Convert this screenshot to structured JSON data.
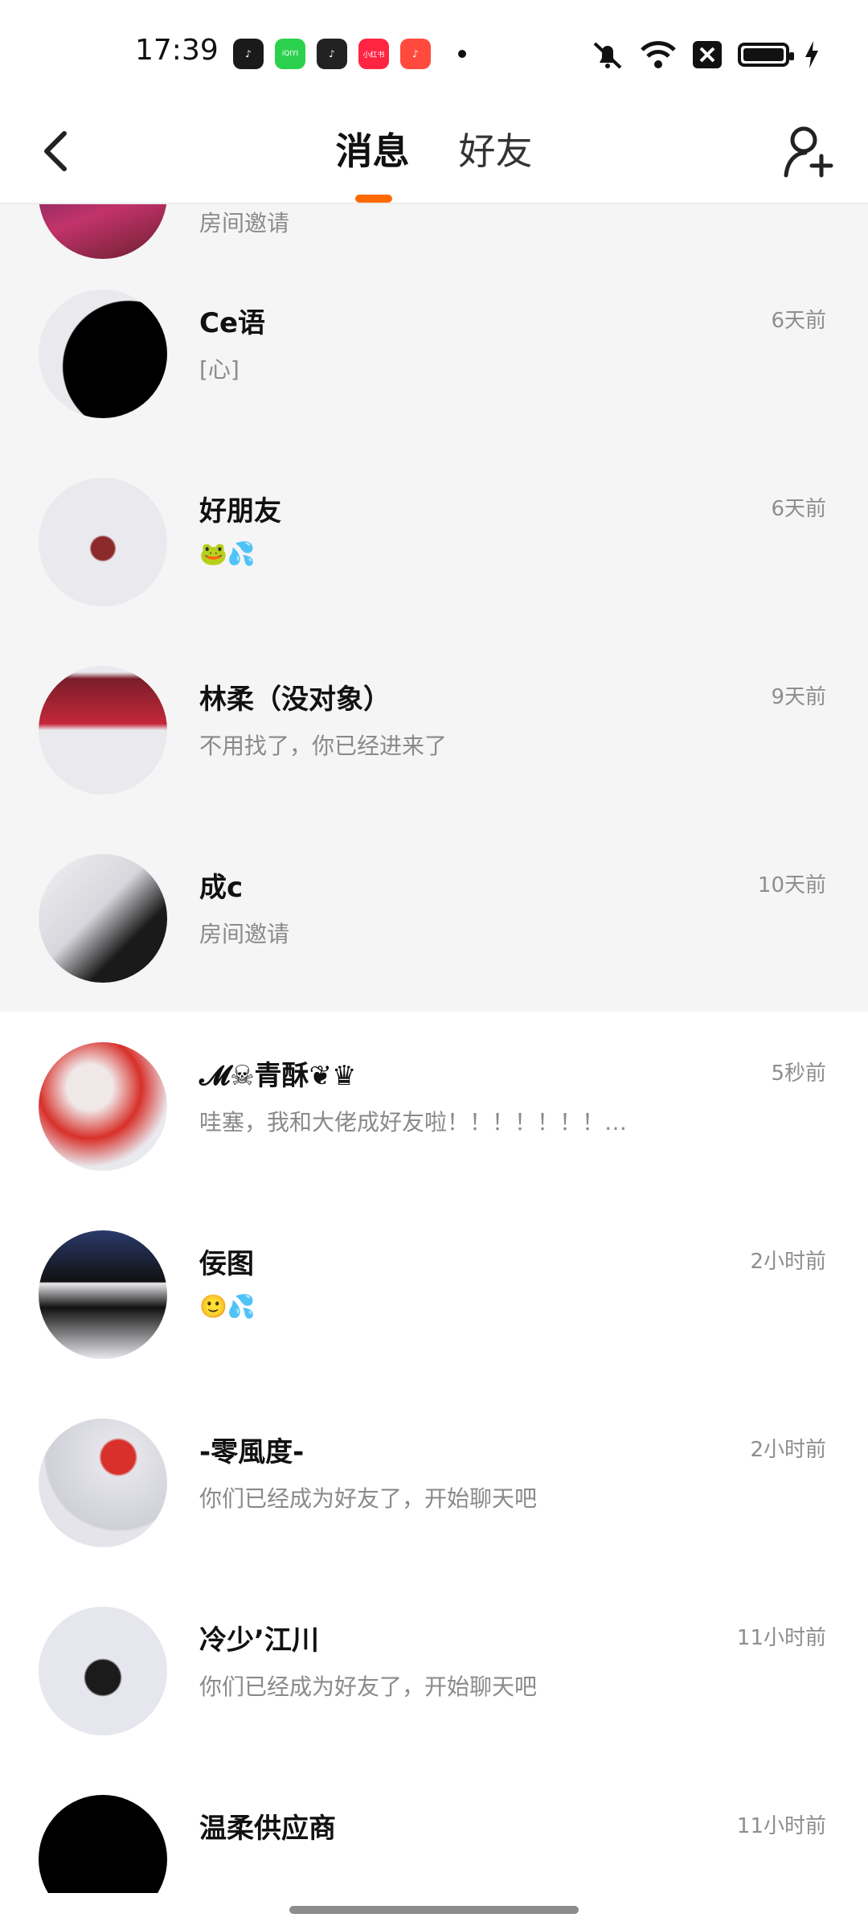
{
  "status_bar": {
    "time": "17:39",
    "apps": [
      {
        "name": "tiktok",
        "color": "#1a1a1a",
        "label": "♪"
      },
      {
        "name": "iqiyi",
        "color": "#2bd14d",
        "label": "iQIYI"
      },
      {
        "name": "tiktok-lite",
        "color": "#222222",
        "label": "♪"
      },
      {
        "name": "xiaohongshu",
        "color": "#ff2442",
        "label": "小红书"
      },
      {
        "name": "music-app",
        "color": "#ff4a3d",
        "label": "♪"
      }
    ]
  },
  "header": {
    "tabs": [
      {
        "label": "消息",
        "active": true
      },
      {
        "label": "好友",
        "active": false
      }
    ],
    "accent_color": "#ff6a00"
  },
  "conversations_grey": [
    {
      "name": "",
      "preview": "房间邀请",
      "time": ""
    },
    {
      "name": "Ce语",
      "preview": "[心]",
      "time": "6天前"
    },
    {
      "name": "好朋友",
      "preview": "🐸💦",
      "time": "6天前"
    },
    {
      "name": "林柔（没对象）",
      "preview": "不用找了，你已经进来了",
      "time": "9天前"
    },
    {
      "name": "成c",
      "preview": "房间邀请",
      "time": "10天前"
    }
  ],
  "conversations_white": [
    {
      "name": "𝓜☠青酥❦♛",
      "preview": "哇塞，我和大佬成好友啦！！！！！！！…",
      "time": "5秒前"
    },
    {
      "name": "佞图",
      "preview": "🙂💦",
      "time": "2小时前"
    },
    {
      "name": "-零風度-",
      "preview": "你们已经成为好友了，开始聊天吧",
      "time": "2小时前"
    },
    {
      "name": "冷少’江川",
      "preview": "你们已经成为好友了，开始聊天吧",
      "time": "11小时前"
    },
    {
      "name": "温柔供应商",
      "preview": "",
      "time": "11小时前"
    }
  ]
}
